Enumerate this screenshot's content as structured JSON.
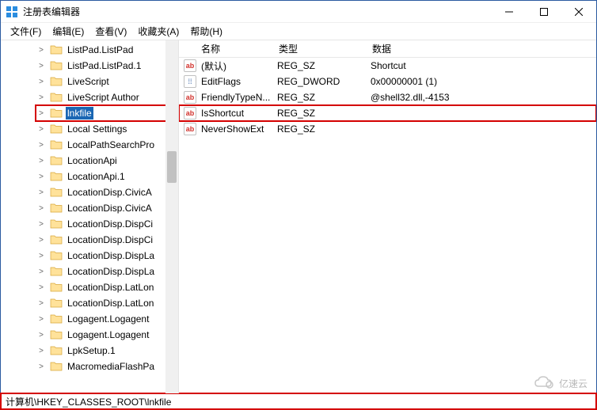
{
  "title": "注册表编辑器",
  "menu": {
    "file": "文件(F)",
    "edit": "编辑(E)",
    "view": "查看(V)",
    "fav": "收藏夹(A)",
    "help": "帮助(H)"
  },
  "tree": [
    {
      "label": "ListPad.ListPad",
      "exp": ">"
    },
    {
      "label": "ListPad.ListPad.1",
      "exp": ">"
    },
    {
      "label": "LiveScript",
      "exp": ">"
    },
    {
      "label": "LiveScript Author",
      "exp": ">"
    },
    {
      "label": "lnkfile",
      "exp": ">",
      "sel": true,
      "red": true
    },
    {
      "label": "Local Settings",
      "exp": ">"
    },
    {
      "label": "LocalPathSearchPro",
      "exp": ">"
    },
    {
      "label": "LocationApi",
      "exp": ">"
    },
    {
      "label": "LocationApi.1",
      "exp": ">"
    },
    {
      "label": "LocationDisp.CivicA",
      "exp": ">"
    },
    {
      "label": "LocationDisp.CivicA",
      "exp": ">"
    },
    {
      "label": "LocationDisp.DispCi",
      "exp": ">"
    },
    {
      "label": "LocationDisp.DispCi",
      "exp": ">"
    },
    {
      "label": "LocationDisp.DispLa",
      "exp": ">"
    },
    {
      "label": "LocationDisp.DispLa",
      "exp": ">"
    },
    {
      "label": "LocationDisp.LatLon",
      "exp": ">"
    },
    {
      "label": "LocationDisp.LatLon",
      "exp": ">"
    },
    {
      "label": "Logagent.Logagent",
      "exp": ">"
    },
    {
      "label": "Logagent.Logagent",
      "exp": ">"
    },
    {
      "label": "LpkSetup.1",
      "exp": ">"
    },
    {
      "label": "MacromediaFlashPa",
      "exp": ">"
    }
  ],
  "cols": {
    "name": "名称",
    "type": "类型",
    "data": "数据"
  },
  "values": [
    {
      "icon": "ab",
      "name": "(默认)",
      "type": "REG_SZ",
      "data": "Shortcut"
    },
    {
      "icon": "bin",
      "name": "EditFlags",
      "type": "REG_DWORD",
      "data": "0x00000001 (1)"
    },
    {
      "icon": "ab",
      "name": "FriendlyTypeN...",
      "type": "REG_SZ",
      "data": "@shell32.dll,-4153"
    },
    {
      "icon": "ab",
      "name": "IsShortcut",
      "type": "REG_SZ",
      "data": "",
      "hl": true
    },
    {
      "icon": "ab",
      "name": "NeverShowExt",
      "type": "REG_SZ",
      "data": ""
    }
  ],
  "status": "计算机\\HKEY_CLASSES_ROOT\\lnkfile",
  "watermark": "亿速云"
}
